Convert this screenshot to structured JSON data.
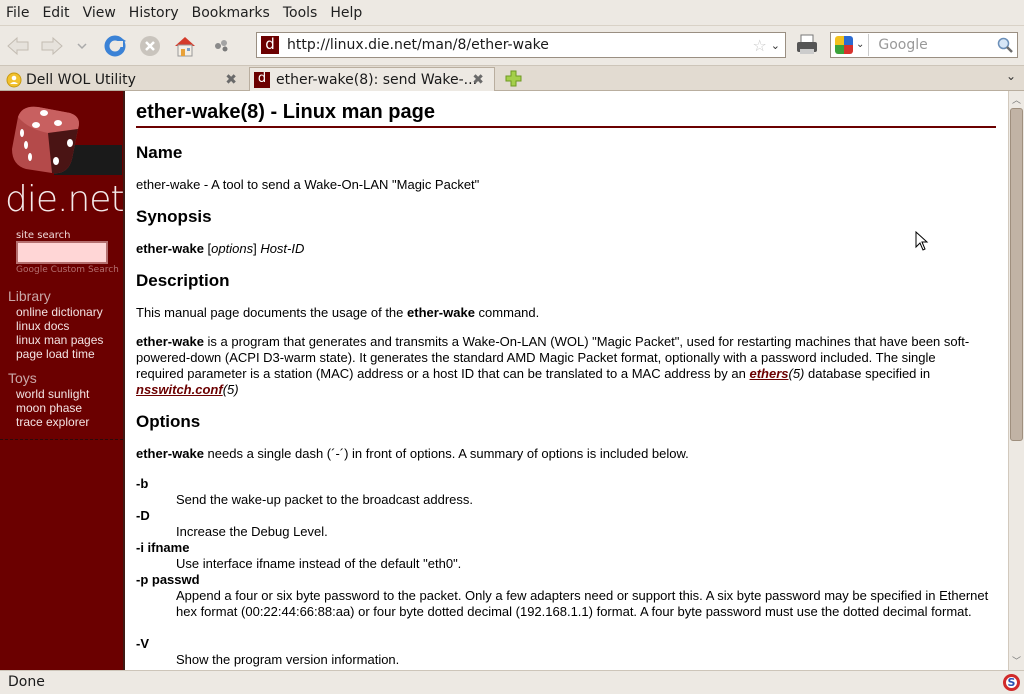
{
  "menu": [
    "File",
    "Edit",
    "View",
    "History",
    "Bookmarks",
    "Tools",
    "Help"
  ],
  "toolbar": {
    "back": "back-icon",
    "forward": "forward-icon",
    "history_dropdown": "chevron-down-icon",
    "reload": "reload-icon",
    "stop": "stop-icon",
    "home": "home-icon",
    "extension": "extension-icon",
    "url": "http://linux.die.net/man/8/ether-wake",
    "print": "printer-icon",
    "search_placeholder": "Google"
  },
  "tabs": [
    {
      "title": "Dell WOL Utility",
      "active": false
    },
    {
      "title": "ether-wake(8): send Wake-...",
      "active": true
    }
  ],
  "sidebar": {
    "logo_text": "die.net",
    "search_label": "site search",
    "search_value": "",
    "search_footer": "Google Custom Search",
    "sections": [
      {
        "heading": "Library",
        "links": [
          "online dictionary",
          "linux docs",
          "linux man pages",
          "page load time"
        ]
      },
      {
        "heading": "Toys",
        "links": [
          "world sunlight",
          "moon phase",
          "trace explorer"
        ]
      }
    ]
  },
  "page": {
    "title": "ether-wake(8) - Linux man page",
    "name_heading": "Name",
    "name_text": "ether-wake - A tool to send a Wake-On-LAN \"Magic Packet\"",
    "synopsis_heading": "Synopsis",
    "synopsis_cmd": "ether-wake",
    "synopsis_options": "options",
    "synopsis_host": "Host-ID",
    "description_heading": "Description",
    "desc1_pre": "This manual page documents the usage of the ",
    "desc1_cmd": "ether-wake",
    "desc1_post": " command.",
    "desc2_cmd": "ether-wake",
    "desc2_text": " is a program that generates and transmits a Wake-On-LAN (WOL) \"Magic Packet\", used for restarting machines that have been soft-powered-down (ACPI D3-warm state). It generates the standard AMD Magic Packet format, optionally with a password included. The single required parameter is a station (MAC) address or a host ID that can be translated to a MAC address by an ",
    "desc2_link1": "ethers",
    "desc2_link1_sec": "(5)",
    "desc2_mid": " database specified in ",
    "desc2_link2": "nsswitch.conf",
    "desc2_link2_sec": "(5)",
    "options_heading": "Options",
    "options_intro_cmd": "ether-wake",
    "options_intro": " needs a single dash (´-´) in front of options. A summary of options is included below.",
    "options": [
      {
        "flag": "-b",
        "desc": "Send the wake-up packet to the broadcast address."
      },
      {
        "flag": "-D",
        "desc": "Increase the Debug Level."
      },
      {
        "flag": "-i ifname",
        "desc": "Use interface ifname instead of the default \"eth0\"."
      },
      {
        "flag": "-p passwd",
        "desc": "Append a four or six byte password to the packet. Only a few adapters need or support this. A six byte password may be specified in Ethernet hex format (00:22:44:66:88:aa) or four byte dotted decimal (192.168.1.1) format. A four byte password must use the dotted decimal format."
      },
      {
        "flag": "-V",
        "desc": "Show the program version information."
      }
    ]
  },
  "status": {
    "text": "Done",
    "addon_icon": "noscript-icon"
  }
}
